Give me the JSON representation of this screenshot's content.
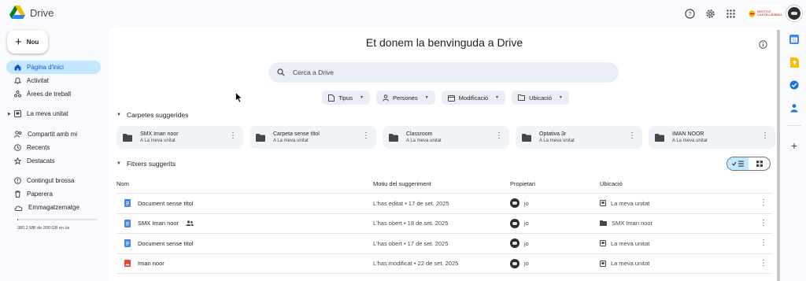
{
  "app": {
    "name": "Drive"
  },
  "topbar": {
    "icons": [
      "help-icon",
      "settings-icon",
      "apps-grid-icon"
    ],
    "org_badge_text": "INSTITUT CASTELLBISBAL"
  },
  "sidebar": {
    "new_label": "Nou",
    "items": [
      {
        "label": "Pàgina d'inici",
        "icon": "home-icon",
        "active": true
      },
      {
        "label": "Activitat",
        "icon": "bell-icon"
      },
      {
        "label": "Àrees de treball",
        "icon": "workspaces-icon"
      },
      {
        "label": "La meva unitat",
        "icon": "my-drive-icon",
        "expandable": true
      },
      {
        "label": "Compartit amb mi",
        "icon": "shared-icon"
      },
      {
        "label": "Recents",
        "icon": "clock-icon"
      },
      {
        "label": "Destacats",
        "icon": "star-icon"
      },
      {
        "label": "Contingut brossa",
        "icon": "spam-icon"
      },
      {
        "label": "Paperera",
        "icon": "trash-icon"
      },
      {
        "label": "Emmagatzematge",
        "icon": "cloud-icon"
      }
    ],
    "storage_text": "380,2 MB de 300 GB en ús",
    "storage_fraction": 0.01
  },
  "main": {
    "title": "Et donem la benvinguda a Drive",
    "search_placeholder": "Cerca a Drive",
    "filters": [
      "Tipus",
      "Persones",
      "Modificació",
      "Ubicació"
    ],
    "suggested_folders_title": "Carpetes suggerides",
    "folders": [
      {
        "name": "SMX Iman noor",
        "location": "A La meva unitat"
      },
      {
        "name": "Carpeta sense títol",
        "location": "A La meva unitat"
      },
      {
        "name": "Classroom",
        "location": "A La meva unitat"
      },
      {
        "name": "Optativa 3r",
        "location": "A La meva unitat"
      },
      {
        "name": "IMAN NOOR",
        "location": "A La meva unitat"
      }
    ],
    "suggested_files_title": "Fitxers suggerits",
    "columns": {
      "name": "Nom",
      "reason": "Motiu del suggeriment",
      "owner": "Propietari",
      "location": "Ubicació"
    },
    "files": [
      {
        "name": "Document sense títol",
        "type": "doc",
        "shared": false,
        "reason": "L'has editat • 17 de set. 2025",
        "owner": "jo",
        "location": "La meva unitat",
        "location_icon": "my-drive-icon"
      },
      {
        "name": "SMX Iman noor",
        "type": "doc",
        "shared": true,
        "reason": "L'has obert • 18 de set. 2025",
        "owner": "jo",
        "location": "SMX Iman noor",
        "location_icon": "folder-icon"
      },
      {
        "name": "Document sense títol",
        "type": "doc",
        "shared": false,
        "reason": "L'has obert • 17 de set. 2025",
        "owner": "jo",
        "location": "La meva unitat",
        "location_icon": "my-drive-icon"
      },
      {
        "name": "Iman noor",
        "type": "image",
        "shared": false,
        "reason": "L'has modificat • 22 de set. 2025",
        "owner": "jo",
        "location": "La meva unitat",
        "location_icon": "my-drive-icon"
      }
    ]
  },
  "colors": {
    "accent": "#0b57d0",
    "active_bg": "#c2e7ff",
    "doc_blue": "#4285f4",
    "image_red": "#ea4335"
  }
}
